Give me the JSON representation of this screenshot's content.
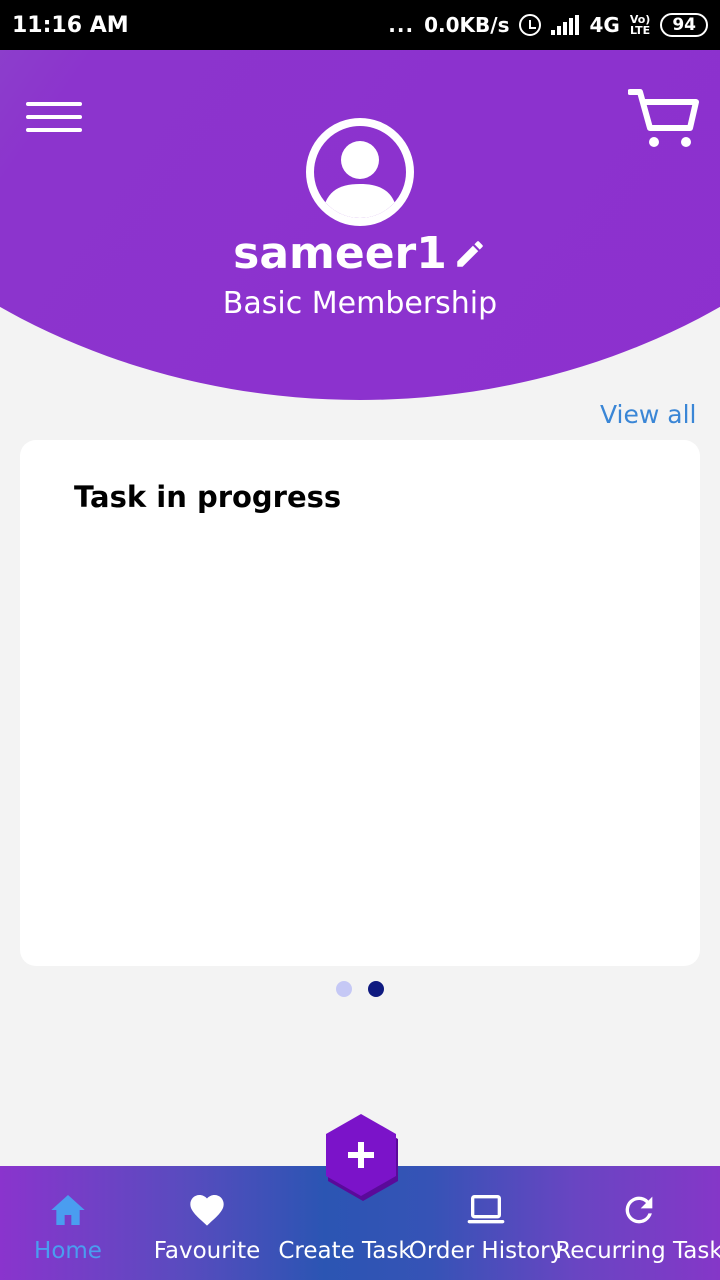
{
  "status_bar": {
    "time": "11:16 AM",
    "dots": "...",
    "speed": "0.0KB/s",
    "network": "4G",
    "volte_top": "Vo)",
    "volte_bottom": "LTE",
    "battery": "94"
  },
  "header": {
    "username": "sameer1",
    "membership": "Basic Membership"
  },
  "view_all": "View all",
  "card": {
    "title": "Task in progress"
  },
  "pager": {
    "count": 2,
    "active_index": 1,
    "inactive_color": "#c5c8f5",
    "active_color": "#0f1a80"
  },
  "bottom_nav": {
    "items": [
      {
        "label": "Home",
        "icon": "home-icon",
        "active": true
      },
      {
        "label": "Favourite",
        "icon": "heart-icon"
      },
      {
        "label": "Create Task",
        "icon": "plus-icon"
      },
      {
        "label": "Order History",
        "icon": "laptop-icon"
      },
      {
        "label": "Recurring Task",
        "icon": "refresh-icon"
      }
    ]
  },
  "colors": {
    "accent_purple": "#8d2fcf",
    "link_blue": "#3a86d6",
    "active_nav": "#4a9df0",
    "fab_purple": "#7b13c9"
  }
}
